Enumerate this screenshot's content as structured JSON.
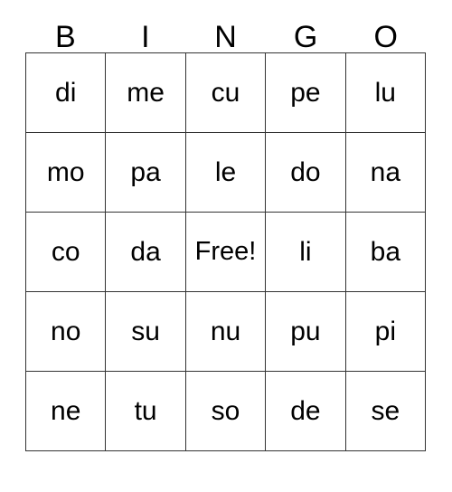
{
  "card": {
    "title": "BINGO",
    "header_letters": [
      "B",
      "I",
      "N",
      "G",
      "O"
    ],
    "colors": {
      "background": "#ffffff",
      "text": "#000000",
      "grid_line": "#333333"
    },
    "free_space_label": "Free!",
    "rows": [
      {
        "cells": [
          {
            "label": "di"
          },
          {
            "label": "me"
          },
          {
            "label": "cu"
          },
          {
            "label": "pe"
          },
          {
            "label": "lu"
          }
        ]
      },
      {
        "cells": [
          {
            "label": "mo"
          },
          {
            "label": "pa"
          },
          {
            "label": "le"
          },
          {
            "label": "do"
          },
          {
            "label": "na"
          }
        ]
      },
      {
        "cells": [
          {
            "label": "co"
          },
          {
            "label": "da"
          },
          {
            "label": "Free!"
          },
          {
            "label": "li"
          },
          {
            "label": "ba"
          }
        ]
      },
      {
        "cells": [
          {
            "label": "no"
          },
          {
            "label": "su"
          },
          {
            "label": "nu"
          },
          {
            "label": "pu"
          },
          {
            "label": "pi"
          }
        ]
      },
      {
        "cells": [
          {
            "label": "ne"
          },
          {
            "label": "tu"
          },
          {
            "label": "so"
          },
          {
            "label": "de"
          },
          {
            "label": "se"
          }
        ]
      }
    ]
  }
}
